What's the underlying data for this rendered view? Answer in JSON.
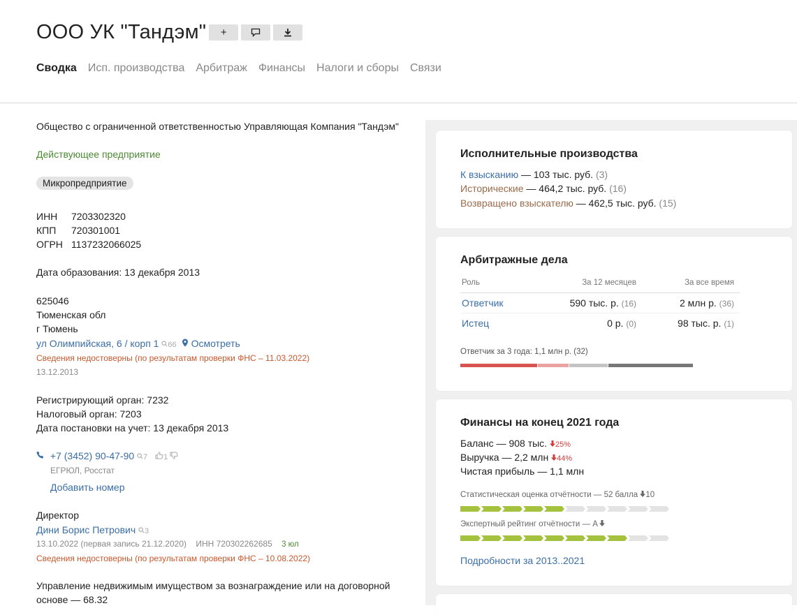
{
  "header": {
    "title": "ООО УК \"Тандэм\"",
    "buttons": [
      {
        "icon": "plus-icon",
        "glyph": "+"
      },
      {
        "icon": "comment-icon",
        "glyph": "🗨"
      },
      {
        "icon": "download-icon",
        "glyph": "⭳"
      }
    ],
    "tabs": [
      "Сводка",
      "Исп. производства",
      "Арбитраж",
      "Финансы",
      "Налоги и сборы",
      "Связи"
    ],
    "active_tab": "Сводка"
  },
  "left": {
    "full_name": "Общество с ограниченной ответственностью Управляющая Компания \"Тандэм\"",
    "status": "Действующее предприятие",
    "size_badge": "Микропредприятие",
    "inn_label": "ИНН",
    "inn": "7203302320",
    "kpp_label": "КПП",
    "kpp": "720301001",
    "ogrn_label": "ОГРН",
    "ogrn": "1137232066025",
    "founded": "Дата образования: 13 декабря 2013",
    "postcode": "625046",
    "region": "Тюменская обл",
    "city": "г Тюмень",
    "street": "ул Олимпийская, 6 / корп 1",
    "street_count": "66",
    "view_link": "Осмотреть",
    "address_warning": "Сведения недостоверны (по результатам проверки ФНС – 11.03.2022)",
    "address_date": "13.12.2013",
    "reg_organ": "Регистрирующий орган: 7232",
    "tax_organ": "Налоговый орган: 7203",
    "registration_date": "Дата постановки на учет: 13 декабря 2013",
    "phone": "+7 (3452) 90-47-90",
    "phone_count": "7",
    "likes": "1",
    "phone_source": "ЕГРЮЛ, Росстат",
    "add_number": "Добавить номер",
    "director_label": "Директор",
    "director_name": "Дини Борис Петрович",
    "director_count": "3",
    "director_dates": "13.10.2022 (первая запись 21.12.2020)",
    "director_inn": "ИНН 720302262685",
    "director_companies": "3 юл",
    "director_warning": "Сведения недостоверны (по результатам проверки ФНС – 10.08.2022)",
    "activity_line1": "Управление недвижимым имуществом за вознаграждение или на договорной",
    "activity_line2": "основе — 68.32"
  },
  "enforcement": {
    "title": "Исполнительные производства",
    "rows": [
      {
        "link": "К взысканию",
        "text": " — 103 тыс. руб.",
        "count": " (3)"
      },
      {
        "link": "Исторические",
        "text": " — 464,2 тыс. руб.",
        "count": " (16)"
      },
      {
        "link": "Возвращено взыскателю",
        "text": " — 462,5 тыс. руб.",
        "count": " (15)"
      }
    ]
  },
  "arbitration": {
    "title": "Арбитражные дела",
    "headers": [
      "Роль",
      "За 12 месяцев",
      "За все время"
    ],
    "rows": [
      {
        "role": "Ответчик",
        "y12": "590 тыс. р.",
        "y12_count": "(16)",
        "all": "2 млн р.",
        "all_count": "(36)"
      },
      {
        "role": "Истец",
        "y12": "0 р.",
        "y12_count": "(0)",
        "all": "98 тыс. р.",
        "all_count": "(1)"
      }
    ],
    "summary": "Ответчик за 3 года: 1,1 млн р. (32)",
    "segments": [
      {
        "share": 0.333,
        "color": "#d9534f"
      },
      {
        "share": 0.135,
        "color": "#eba3a1"
      },
      {
        "share": 0.165,
        "color": "#c4c4c4"
      },
      {
        "share": 0.367,
        "color": "#777777"
      }
    ],
    "colors": {
      "link": "#3a6ea5"
    }
  },
  "finance": {
    "title": "Финансы на конец 2021 года",
    "balance": "Баланс — 908 тыс.",
    "balance_change": "25%",
    "revenue": "Выручка — 2,2 млн",
    "revenue_change": "44%",
    "profit": "Чистая прибыль — 1,1 млн",
    "stat_label": "Статистическая оценка отчётности — 52 балла",
    "stat_delta": "10",
    "stat_filled": 5,
    "stat_total": 10,
    "expert_label": "Экспертный рейтинг отчётности — A",
    "expert_filled": 8,
    "expert_total": 10,
    "details_link": "Подробности за 2013..2021",
    "colors": {
      "fill": "#a5c23e",
      "empty": "#e3e3e3",
      "down": "#d23d3d"
    }
  }
}
